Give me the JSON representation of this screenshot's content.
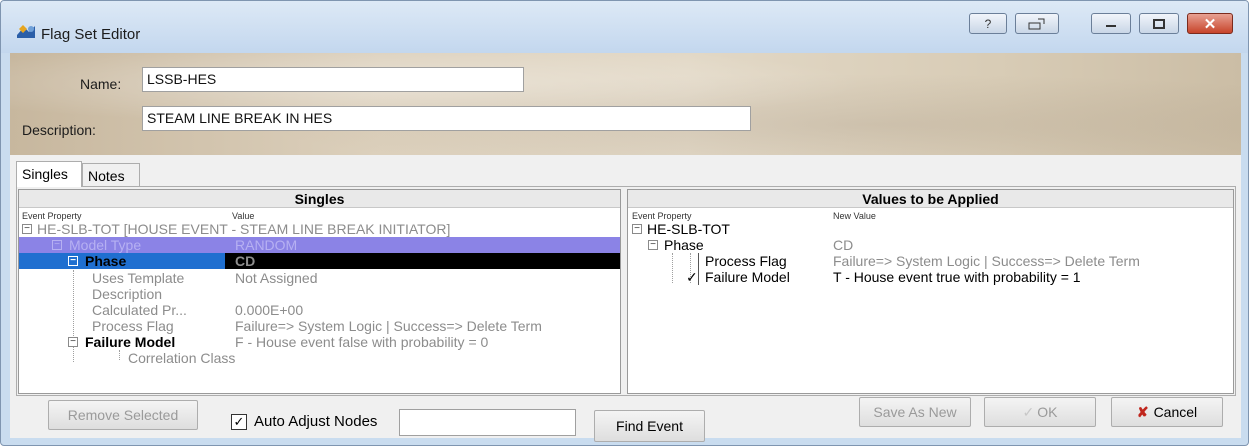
{
  "window": {
    "title": "Flag Set Editor",
    "controls": {
      "help": "?",
      "restore_icon": "restore-icon",
      "minimize_icon": "minimize-icon",
      "maximize_icon": "maximize-icon",
      "close": "✕"
    }
  },
  "header": {
    "name_label": "Name:",
    "name_value": "LSSB-HES",
    "description_label": "Description:",
    "description_value": "STEAM LINE BREAK IN HES"
  },
  "tabs": [
    {
      "label": "Singles",
      "active": true
    },
    {
      "label": "Notes",
      "active": false
    }
  ],
  "singles_grid": {
    "title": "Singles",
    "col_property": "Event Property",
    "col_value": "Value",
    "root": "HE-SLB-TOT  [HOUSE EVENT - STEAM LINE BREAK INITIATOR]",
    "rows": [
      {
        "property": "Model Type",
        "value": "RANDOM"
      },
      {
        "property": "Phase",
        "value": "CD"
      },
      {
        "property": "Uses Template",
        "value": "Not Assigned"
      },
      {
        "property": "Description",
        "value": ""
      },
      {
        "property": "Calculated Pr...",
        "value": "0.000E+00"
      },
      {
        "property": "Process Flag",
        "value": "Failure=> System Logic    | Success=> Delete Term"
      },
      {
        "property": "Failure Model",
        "value": "F - House event false with probability = 0"
      },
      {
        "property": "Correlation Class",
        "value": ""
      }
    ]
  },
  "values_grid": {
    "title": "Values to be Applied",
    "col_property": "Event Property",
    "col_value": "New Value",
    "root": "HE-SLB-TOT",
    "phase_label": "Phase",
    "phase_value": "CD",
    "rows": [
      {
        "property": "Process Flag",
        "value": "Failure=> System Logic    | Success=> Delete Term"
      },
      {
        "property": "Failure Model",
        "value": "T - House event true with probability = 1"
      }
    ]
  },
  "footer": {
    "remove_selected": "Remove Selected",
    "auto_adjust_label": "Auto Adjust Nodes",
    "auto_adjust_checked": true,
    "search_value": "",
    "find_event": "Find Event",
    "save_as_new": "Save As New",
    "ok": "OK",
    "cancel": "Cancel"
  },
  "colors": {
    "selection_blue": "#1f6fd0",
    "row_purple": "#8b83e6",
    "cancel_red": "#c0261d"
  }
}
